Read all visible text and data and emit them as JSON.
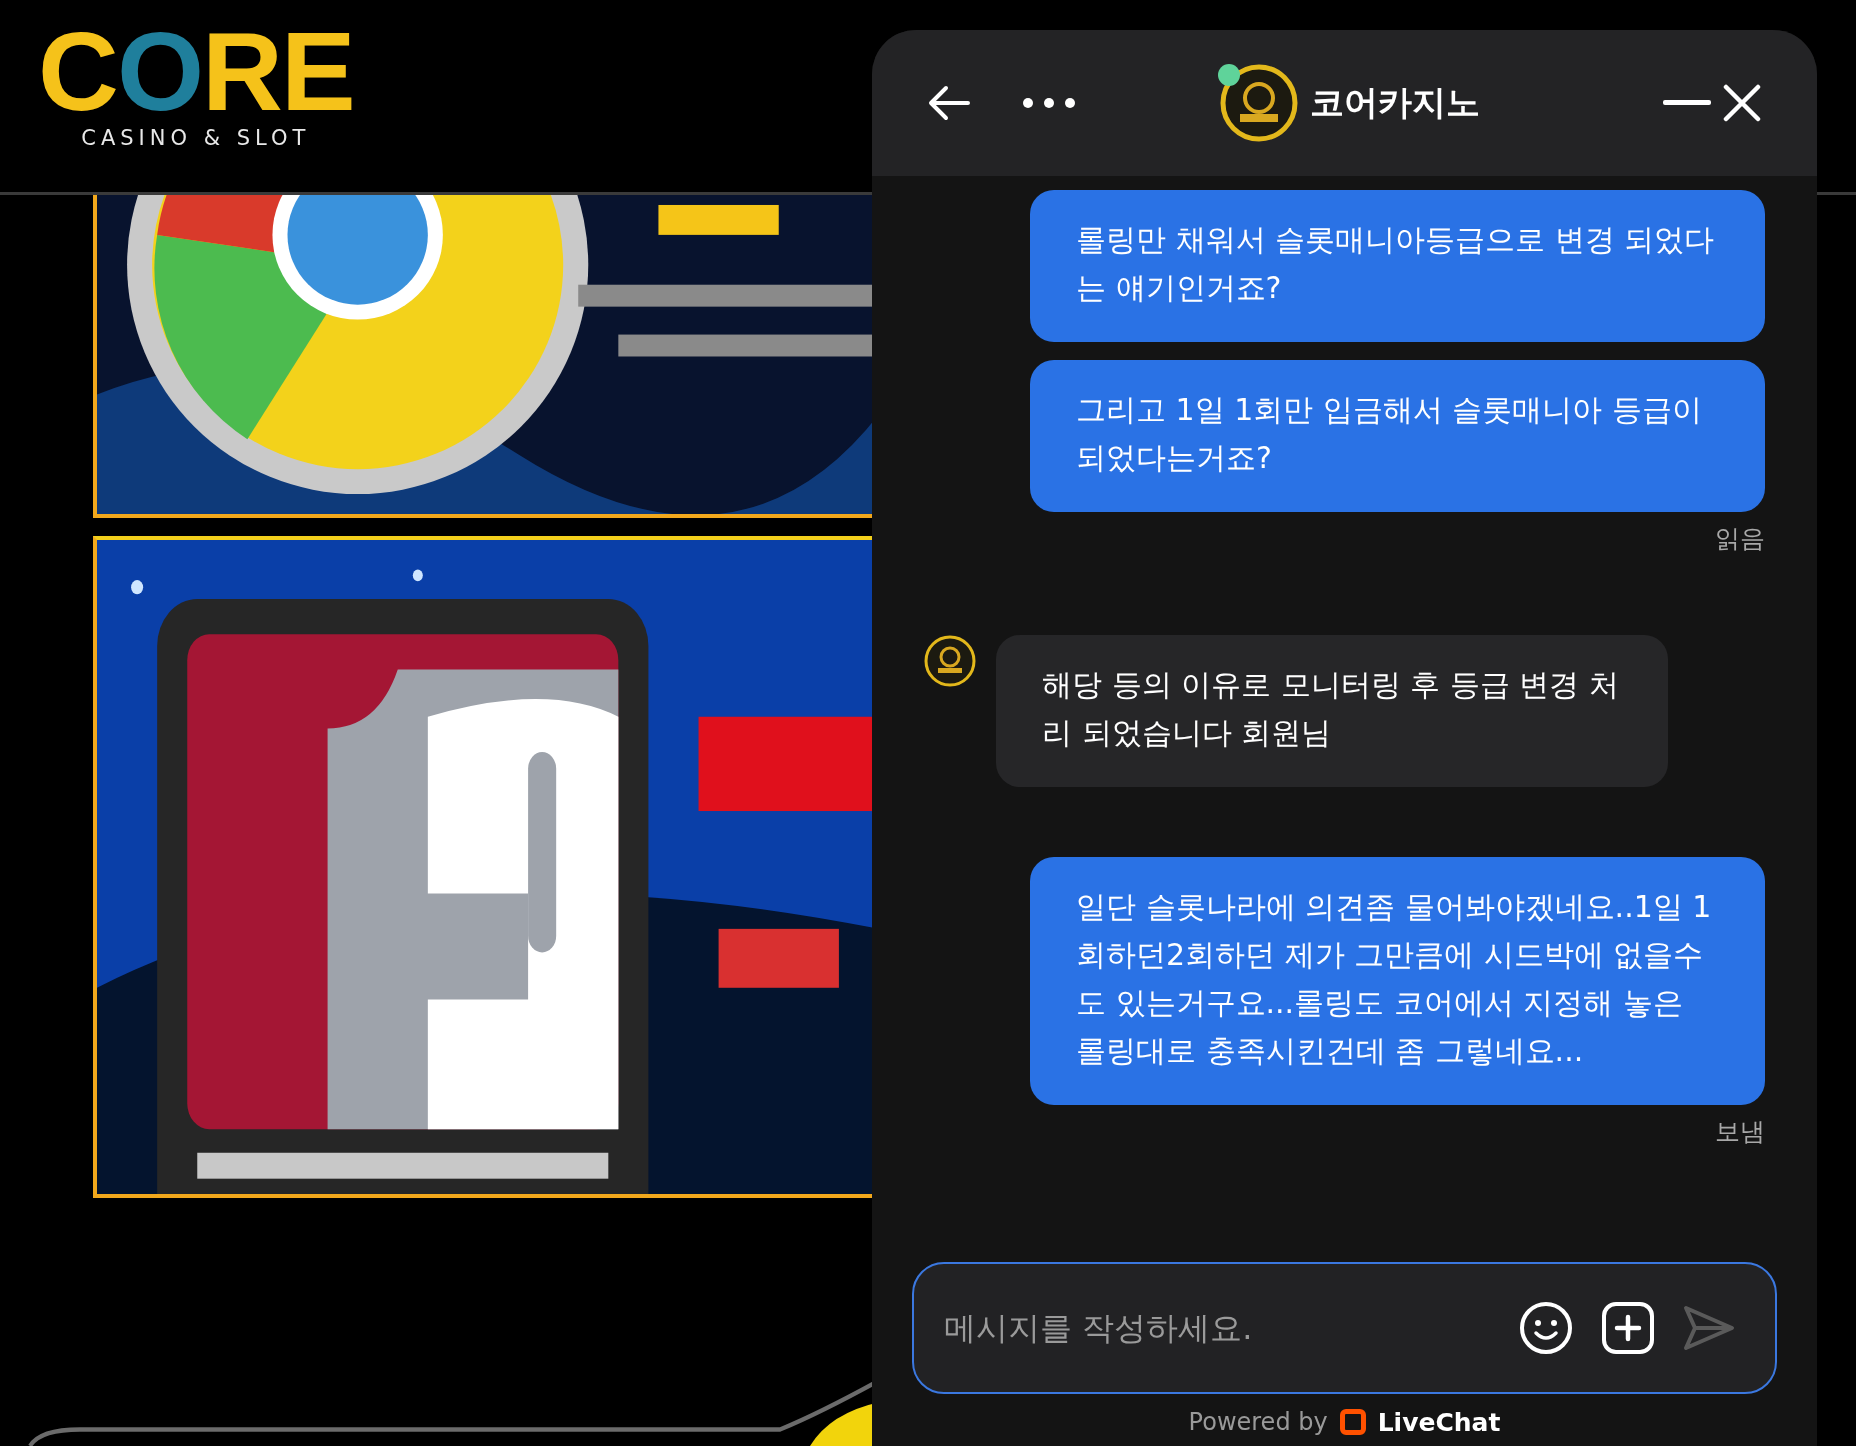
{
  "site": {
    "logo": {
      "wordmark": "CORE",
      "tagline": "CASINO & SLOT"
    }
  },
  "chat": {
    "title": "코어카지노",
    "agent_online": true,
    "messages": [
      {
        "kind": "visitor",
        "text": "롤링만 채워서 슬롯매니아등급으로 변경 되었다는 얘기인거죠?"
      },
      {
        "kind": "visitor",
        "text": "그리고 1일 1회만 입금해서 슬롯매니아 등급이 되었다는거죠?",
        "status": "읽음"
      },
      {
        "kind": "agent",
        "text": "해당 등의 이유로 모니터링 후 등급 변경 처리 되었습니다 회원님"
      },
      {
        "kind": "visitor",
        "text": "일단 슬롯나라에 의견좀 물어봐야겠네요..1일 1회하던2회하던 제가 그만큼에 시드박에 없을수도 있는거구요...롤링도 코어에서 지정해 놓은 롤링대로 충족시킨건데 좀 그렇네요...",
        "status": "보냄"
      }
    ],
    "input": {
      "placeholder": "메시지를 작성하세요."
    },
    "footer": {
      "prefix": "Powered by",
      "brand": "LiveChat"
    }
  }
}
